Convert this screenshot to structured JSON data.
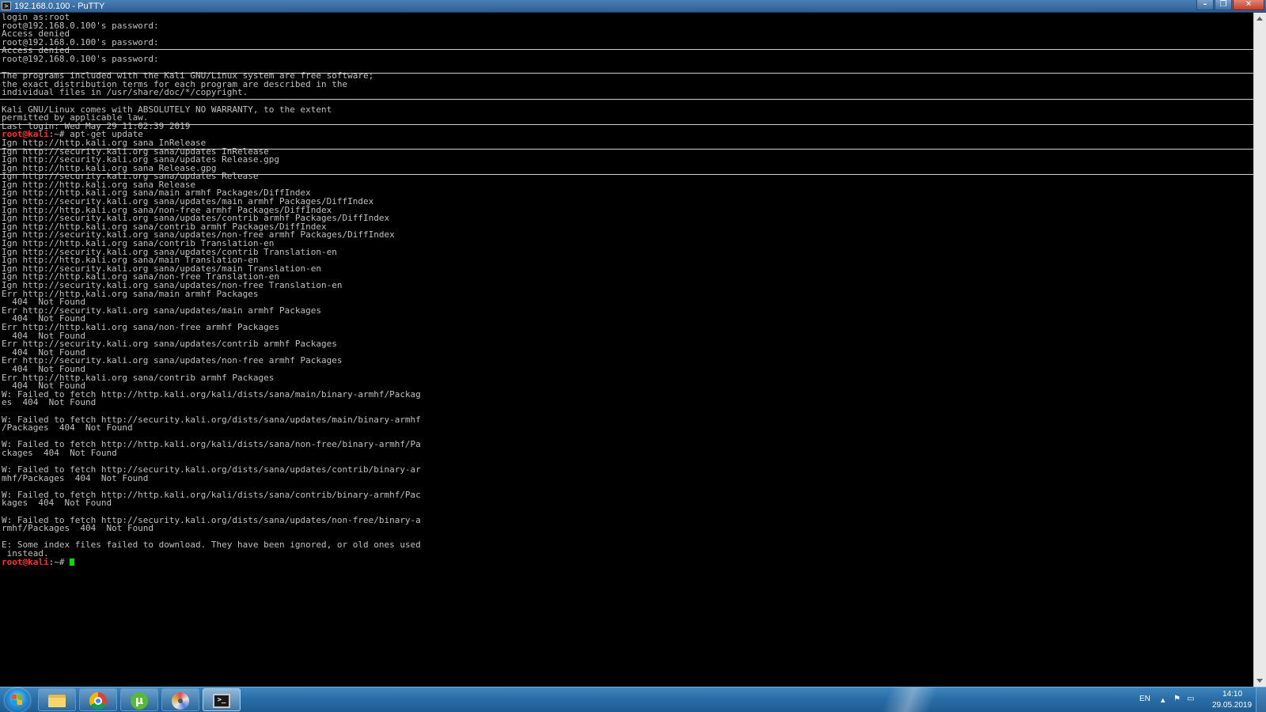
{
  "window": {
    "title": "192.168.0.100 - PuTTY",
    "icon": "putty-terminal-icon",
    "controls": {
      "minimize": "–",
      "maximize": "❐",
      "close": "✕"
    }
  },
  "colors": {
    "terminal_bg": "#000000",
    "terminal_fg": "#c0c0c0",
    "prompt_user": "#ff3030",
    "cursor": "#00e000",
    "taskbar": "#2a6ea7"
  },
  "terminal": {
    "lines": [
      "login as:root",
      "root@192.168.0.100's password:",
      "Access denied",
      "root@192.168.0.100's password:",
      "Access denied",
      "root@192.168.0.100's password:",
      "",
      "The programs included with the Kali GNU/Linux system are free software;",
      "the exact distribution terms for each program are described in the",
      "individual files in /usr/share/doc/*/copyright.",
      "",
      "Kali GNU/Linux comes with ABSOLUTELY NO WARRANTY, to the extent",
      "permitted by applicable law.",
      "Last login: Wed May 29 11:02:39 2019",
      {
        "prompt": "root@kali",
        "rest": ":~# apt-get update"
      },
      "Ign http://http.kali.org sana InRelease",
      "Ign http://security.kali.org sana/updates InRelease",
      "Ign http://security.kali.org sana/updates Release.gpg",
      "Ign http://http.kali.org sana Release.gpg",
      "Ign http://security.kali.org sana/updates Release",
      "Ign http://http.kali.org sana Release",
      "Ign http://http.kali.org sana/main armhf Packages/DiffIndex",
      "Ign http://security.kali.org sana/updates/main armhf Packages/DiffIndex",
      "Ign http://http.kali.org sana/non-free armhf Packages/DiffIndex",
      "Ign http://security.kali.org sana/updates/contrib armhf Packages/DiffIndex",
      "Ign http://http.kali.org sana/contrib armhf Packages/DiffIndex",
      "Ign http://security.kali.org sana/updates/non-free armhf Packages/DiffIndex",
      "Ign http://http.kali.org sana/contrib Translation-en",
      "Ign http://security.kali.org sana/updates/contrib Translation-en",
      "Ign http://http.kali.org sana/main Translation-en",
      "Ign http://security.kali.org sana/updates/main Translation-en",
      "Ign http://http.kali.org sana/non-free Translation-en",
      "Ign http://security.kali.org sana/updates/non-free Translation-en",
      "Err http://http.kali.org sana/main armhf Packages",
      "  404  Not Found",
      "Err http://security.kali.org sana/updates/main armhf Packages",
      "  404  Not Found",
      "Err http://http.kali.org sana/non-free armhf Packages",
      "  404  Not Found",
      "Err http://security.kali.org sana/updates/contrib armhf Packages",
      "  404  Not Found",
      "Err http://security.kali.org sana/updates/non-free armhf Packages",
      "  404  Not Found",
      "Err http://http.kali.org sana/contrib armhf Packages",
      "  404  Not Found",
      "W: Failed to fetch http://http.kali.org/kali/dists/sana/main/binary-armhf/Packag",
      "es  404  Not Found",
      "",
      "W: Failed to fetch http://security.kali.org/dists/sana/updates/main/binary-armhf",
      "/Packages  404  Not Found",
      "",
      "W: Failed to fetch http://http.kali.org/kali/dists/sana/non-free/binary-armhf/Pa",
      "ckages  404  Not Found",
      "",
      "W: Failed to fetch http://security.kali.org/dists/sana/updates/contrib/binary-ar",
      "mhf/Packages  404  Not Found",
      "",
      "W: Failed to fetch http://http.kali.org/kali/dists/sana/contrib/binary-armhf/Pac",
      "kages  404  Not Found",
      "",
      "W: Failed to fetch http://security.kali.org/dists/sana/updates/non-free/binary-a",
      "rmhf/Packages  404  Not Found",
      "",
      "E: Some index files failed to download. They have been ignored, or old ones used",
      " instead.",
      {
        "prompt": "root@kali",
        "rest": ":~# ",
        "cursor": true
      }
    ]
  },
  "taskbar": {
    "start": "start-orb-icon",
    "apps": [
      {
        "name": "taskbar-explorer",
        "icon": "folder-icon"
      },
      {
        "name": "taskbar-chrome",
        "icon": "chrome-icon"
      },
      {
        "name": "taskbar-utorrent",
        "icon": "utorrent-icon",
        "glyph": "μ"
      },
      {
        "name": "taskbar-media",
        "icon": "disc-icon"
      },
      {
        "name": "taskbar-putty",
        "icon": "putty-icon",
        "glyph": ">_"
      }
    ],
    "tray": {
      "language": "EN",
      "show_hidden_glyph": "▲",
      "time": "14:10",
      "date": "29.05.2019"
    }
  }
}
